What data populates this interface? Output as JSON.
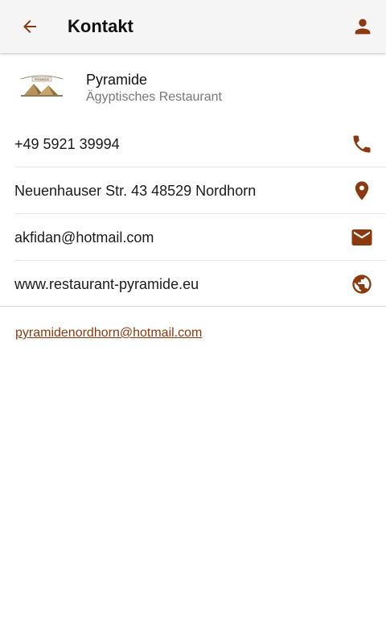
{
  "colors": {
    "accent": "#8b3a10",
    "appbar_bg": "#f5f5f5"
  },
  "appbar": {
    "title": "Kontakt",
    "back_icon": "arrow-left-icon",
    "user_icon": "person-icon"
  },
  "restaurant": {
    "name": "Pyramide",
    "subtitle": "Ägyptisches Restaurant",
    "logo_text": "PYRAMIDE"
  },
  "contacts": [
    {
      "label": "+49 5921 39994",
      "icon": "phone-icon"
    },
    {
      "label": "Neuenhauser Str. 43 48529 Nordhorn",
      "icon": "location-pin-icon"
    },
    {
      "label": "akfidan@hotmail.com",
      "icon": "mail-icon"
    },
    {
      "label": "www.restaurant-pyramide.eu",
      "icon": "globe-icon"
    }
  ],
  "footer_email": "pyramidenordhorn@hotmail.com"
}
